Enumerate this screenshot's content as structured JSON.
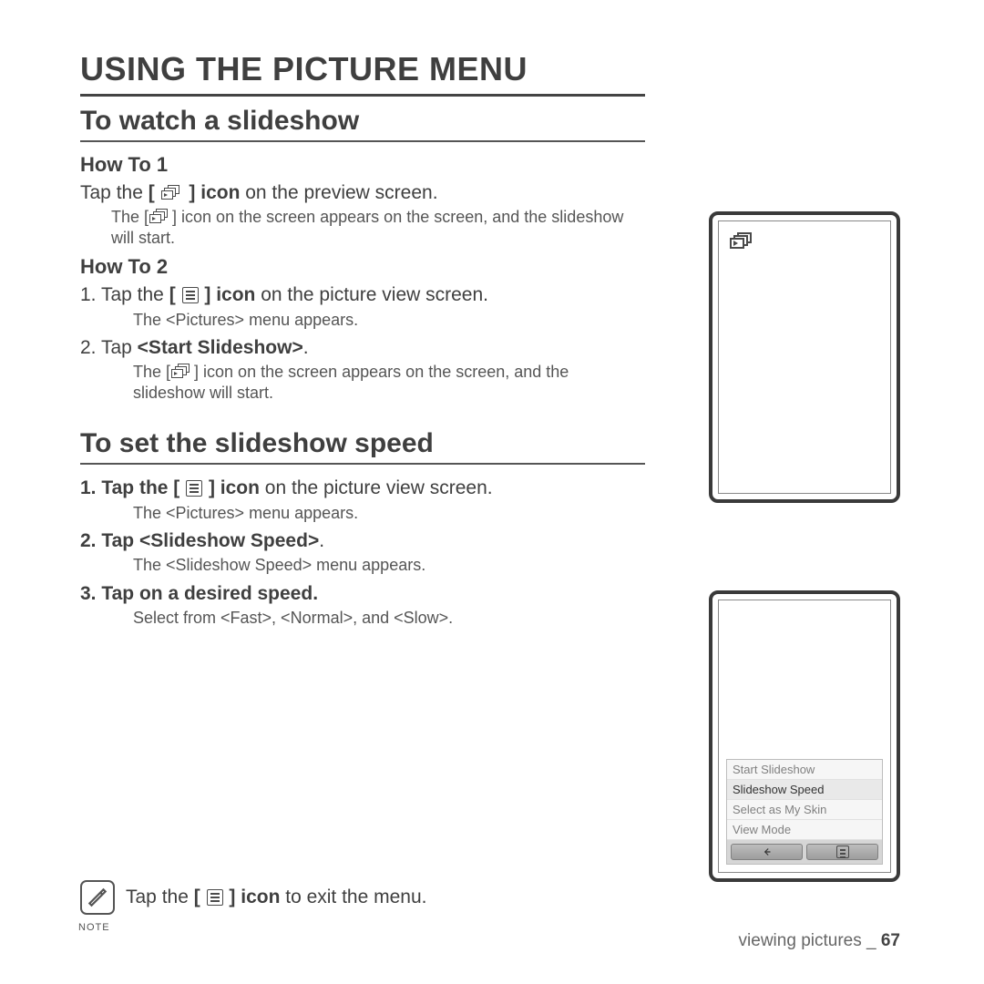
{
  "page_title": "USING THE PICTURE MENU",
  "section1": {
    "title": "To watch a slideshow",
    "how1_label": "How To 1",
    "how1_line_a": "Tap the ",
    "how1_line_b": " on the preview screen.",
    "how1_bold": "icon",
    "how1_sub_a": "The [",
    "how1_sub_b": "] icon on the screen appears on the screen, and the slideshow will start.",
    "how2_label": "How To 2",
    "how2_step1_a": "1.  Tap the ",
    "how2_step1_bold": "icon",
    "how2_step1_b": " on the picture view screen.",
    "how2_step1_sub": "The <Pictures> menu appears.",
    "how2_step2_a": "2.  Tap ",
    "how2_step2_bold": "<Start Slideshow>",
    "how2_step2_b": ".",
    "how2_step2_sub_a": "The [",
    "how2_step2_sub_b": "] icon on the screen appears on the screen, and the slideshow will start."
  },
  "section2": {
    "title": "To set the slideshow speed",
    "s1_a": "1.  Tap the ",
    "s1_bold": "icon",
    "s1_b": " on the picture view screen.",
    "s1_sub": "The <Pictures> menu appears.",
    "s2_a": "2.  Tap ",
    "s2_bold": "<Slideshow Speed>",
    "s2_b": ".",
    "s2_sub": "The <Slideshow Speed> menu appears.",
    "s3_a": "3.  Tap on a desired speed.",
    "s3_sub": "Select from <Fast>, <Normal>, and <Slow>."
  },
  "menu": {
    "items": [
      "Start Slideshow",
      "Slideshow Speed",
      "Select as My Skin",
      "View Mode"
    ],
    "selected_index": 1
  },
  "note": {
    "label": "NOTE",
    "text_a": "Tap the ",
    "text_bold": "icon",
    "text_b": " to exit the menu."
  },
  "footer": {
    "section": "viewing pictures _",
    "page": "67"
  }
}
